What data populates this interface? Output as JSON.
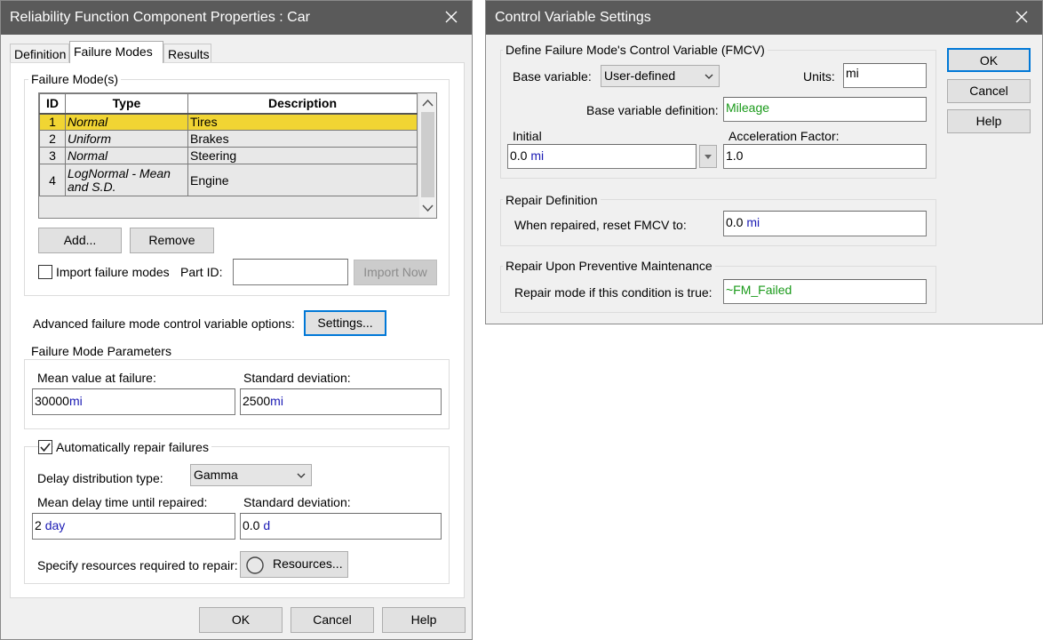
{
  "left_dialog": {
    "title": "Reliability Function Component Properties : Car",
    "tabs": [
      "Definition",
      "Failure Modes",
      "Results"
    ],
    "failure_modes_group": "Failure Mode(s)",
    "table": {
      "headers": [
        "ID",
        "Type",
        "Description"
      ],
      "rows": [
        {
          "id": "1",
          "type": "Normal",
          "description": "Tires"
        },
        {
          "id": "2",
          "type": "Uniform",
          "description": "Brakes"
        },
        {
          "id": "3",
          "type": "Normal",
          "description": "Steering"
        },
        {
          "id": "4",
          "type": "LogNormal - Mean and S.D.",
          "description": "Engine"
        }
      ],
      "selected_row": 0
    },
    "add_button": "Add...",
    "remove_button": "Remove",
    "import_checkbox_label": "Import failure modes",
    "import_checked": false,
    "part_id_label": "Part ID:",
    "part_id_value": "",
    "import_now_button": "Import Now",
    "advanced_label": "Advanced failure mode control variable options:",
    "settings_button": "Settings...",
    "params_group": "Failure Mode Parameters",
    "mean_label": "Mean value at failure:",
    "mean_value": "30000",
    "mean_unit": "mi",
    "stddev_label": "Standard deviation:",
    "stddev_value": "2500",
    "stddev_unit": "mi",
    "auto_repair_label": "Automatically repair failures",
    "auto_repair_checked": true,
    "delay_type_label": "Delay distribution type:",
    "delay_type_value": "Gamma",
    "mean_delay_label": "Mean delay time until repaired:",
    "mean_delay_value": "2",
    "mean_delay_unit": "day",
    "delay_stddev_label": "Standard deviation:",
    "delay_stddev_value": "0.0",
    "delay_stddev_unit": "d",
    "resources_label": "Specify resources required to repair:",
    "resources_button": "Resources...",
    "ok_button": "OK",
    "cancel_button": "Cancel",
    "help_button": "Help"
  },
  "right_dialog": {
    "title": "Control Variable Settings",
    "fmcv_group": "Define Failure Mode's Control Variable (FMCV)",
    "base_variable_label": "Base variable:",
    "base_variable_value": "User-defined",
    "units_label": "Units:",
    "units_value": "mi",
    "base_def_label": "Base variable definition:",
    "base_def_value": "Mileage",
    "initial_label": "Initial",
    "initial_value": "0.0",
    "initial_unit": "mi",
    "accel_label": "Acceleration Factor:",
    "accel_value": "1.0",
    "repair_group": "Repair Definition",
    "reset_label": "When repaired, reset FMCV to:",
    "reset_value": "0.0",
    "reset_unit": "mi",
    "pm_group": "Repair Upon Preventive Maintenance",
    "pm_label": "Repair mode if this condition is true:",
    "pm_value": "~FM_Failed",
    "ok_button": "OK",
    "cancel_button": "Cancel",
    "help_button": "Help"
  },
  "colors": {
    "titlebar": "#5a5a5a",
    "selected_row": "#f1d533",
    "unit_text": "#1a1ab4",
    "expression_text": "#1a9a1a",
    "default_button_border": "#0078d7"
  }
}
